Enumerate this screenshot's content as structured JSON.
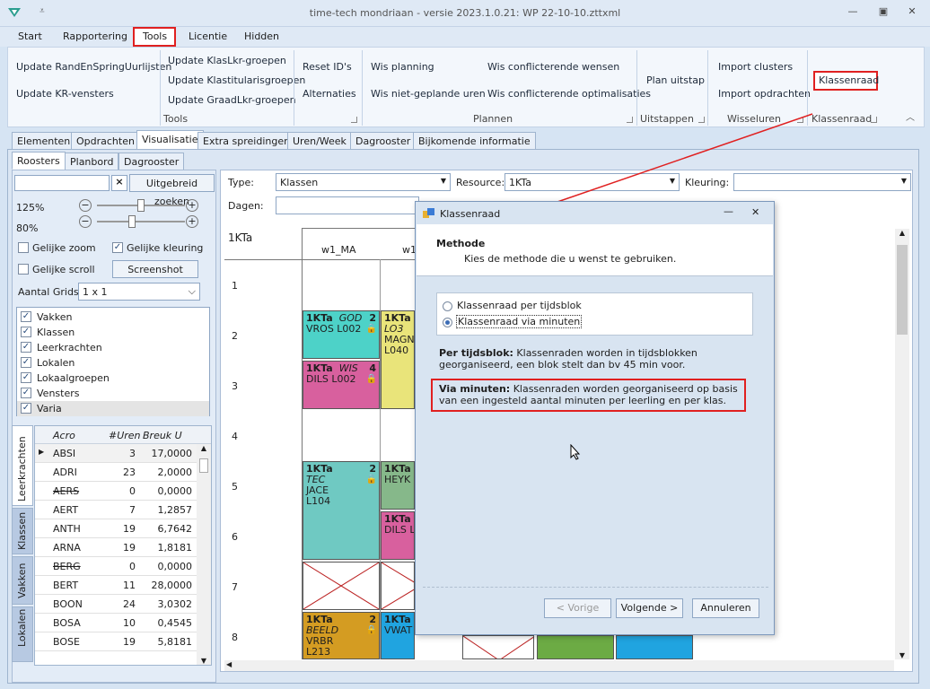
{
  "window": {
    "title": "time-tech mondriaan - versie 2023.1.0.21: WP 22-10-10.zttxml"
  },
  "menu": [
    "Start",
    "Rapportering",
    "Tools",
    "Licentie",
    "Hidden"
  ],
  "ribbon": {
    "tools_buttons": [
      "Update RandEnSpringUurlijsten",
      "Update KR-vensters",
      "Update KlasLkr-groepen",
      "Update Klastitularisgroepen",
      "Update GraadLkr-groepen",
      "Reset ID's",
      "Alternaties"
    ],
    "tools_group": "Tools",
    "plannen_buttons": [
      "Wis planning",
      "Wis niet-geplande uren",
      "Wis conflicterende wensen",
      "Wis conflicterende optimalisaties"
    ],
    "plannen_group": "Plannen",
    "uitstappen_button": "Plan uitstap",
    "uitstappen_group": "Uitstappen",
    "wisseluren_buttons": [
      "Import clusters",
      "Import opdrachten"
    ],
    "wisseluren_group": "Wisseluren",
    "klassenraad_button": "Klassenraad",
    "klassenraad_group": "Klassenraad"
  },
  "tabs": [
    "Elementen",
    "Opdrachten",
    "Visualisatie",
    "Extra spreidingen",
    "Uren/Week",
    "Dagrooster",
    "Bijkomende informatie"
  ],
  "subtabs": [
    "Roosters",
    "Planbord",
    "Dagrooster"
  ],
  "left": {
    "search_placeholder": "",
    "clear": "×",
    "advanced_search": "Uitgebreid zoeken",
    "zoom1": "125%",
    "zoom2": "80%",
    "slider1": 0.5,
    "slider2": 0.4,
    "gelijke_zoom": "Gelijke zoom",
    "gelijke_kleuring": "Gelijke kleuring",
    "gelijke_scroll": "Gelijke scroll",
    "screenshot": "Screenshot",
    "aantal_grids_label": "Aantal Grids",
    "aantal_grids_value": "1 x 1",
    "checklist": [
      "Vakken",
      "Klassen",
      "Leerkrachten",
      "Lokalen",
      "Lokaalgroepen",
      "Vensters",
      "Varia"
    ],
    "vtabs": [
      "Leerkrachten",
      "Klassen",
      "Vakken",
      "Lokalen"
    ],
    "table_headers": [
      "Acro",
      "#Uren",
      "Breuk U"
    ],
    "table_rows": [
      [
        "ABSI",
        "3",
        "17,0000"
      ],
      [
        "ADRI",
        "23",
        "2,0000"
      ],
      [
        "AERS",
        "0",
        "0,0000"
      ],
      [
        "AERT",
        "7",
        "1,2857"
      ],
      [
        "ANTH",
        "19",
        "6,7642"
      ],
      [
        "ARNA",
        "19",
        "1,8181"
      ],
      [
        "BERG",
        "0",
        "0,0000"
      ],
      [
        "BERT",
        "11",
        "28,0000"
      ],
      [
        "BOON",
        "24",
        "3,0302"
      ],
      [
        "BOSA",
        "10",
        "0,4545"
      ],
      [
        "BOSE",
        "19",
        "5,8181"
      ]
    ]
  },
  "schedule": {
    "type_label": "Type:",
    "type_value": "Klassen",
    "resource_label": "Resource:",
    "resource_value": "1KTa",
    "kleuring_label": "Kleuring:",
    "kleuring_value": "",
    "dagen_label": "Dagen:",
    "resource_title": "1KTa",
    "col1": "w1_MA",
    "col2": "w1",
    "rows": [
      "1",
      "2",
      "3",
      "4",
      "5",
      "6",
      "7",
      "8"
    ],
    "slots": [
      {
        "l1": "1KTa",
        "l1b": "GOD",
        "n": "2",
        "l2": "VROS  L002",
        "color": "#4dd2c8"
      },
      {
        "l1": "1KTa",
        "l1b": "WIS",
        "n": "4",
        "l2": "DILS  L002",
        "color": "#d8609e"
      },
      {
        "l1": "1KTa",
        "l1b": "",
        "n": "2",
        "l2": "TEC",
        "l3": "JACE",
        "l4": "L104",
        "color": "#6fc9c2"
      },
      {
        "l1": "1KTa",
        "l1b": "",
        "n": "2",
        "l2": "BEELD",
        "l3": "VRBR",
        "l4": "L213",
        "color": "#d49c22"
      },
      {
        "l1": "1KTa",
        "l1b": "",
        "n": "",
        "l2": "LO3",
        "l3": "MAGN",
        "l4": "L040",
        "color": "#e9e47a"
      },
      {
        "l1": "1KTa",
        "l1b": "",
        "n": "",
        "l2": "HEYK",
        "color": "#86b88a"
      },
      {
        "l1": "1KTa",
        "l1b": "",
        "n": "",
        "l2": "DILS  L",
        "color": "#d8609e"
      },
      {
        "l1": "1KTa",
        "l1b": "",
        "n": "",
        "l2": "VWAT",
        "color": "#20a4e0"
      }
    ]
  },
  "dialog": {
    "title": "Klassenraad",
    "heading": "Methode",
    "subheading": "Kies de methode die u wenst te gebruiken.",
    "option1": "Klassenraad per tijdsblok",
    "option2": "Klassenraad via minuten",
    "desc1_bold": "Per tijdsblok:",
    "desc1": "Klassenraden worden in tijdsblokken georganiseerd, een blok stelt dan bv 45 min voor.",
    "desc2_bold": "Via minuten:",
    "desc2": "Klassenraden worden georganiseerd op basis van een ingesteld aantal minuten per leerling en per klas.",
    "prev": "< Vorige",
    "next": "Volgende >",
    "cancel": "Annuleren"
  }
}
